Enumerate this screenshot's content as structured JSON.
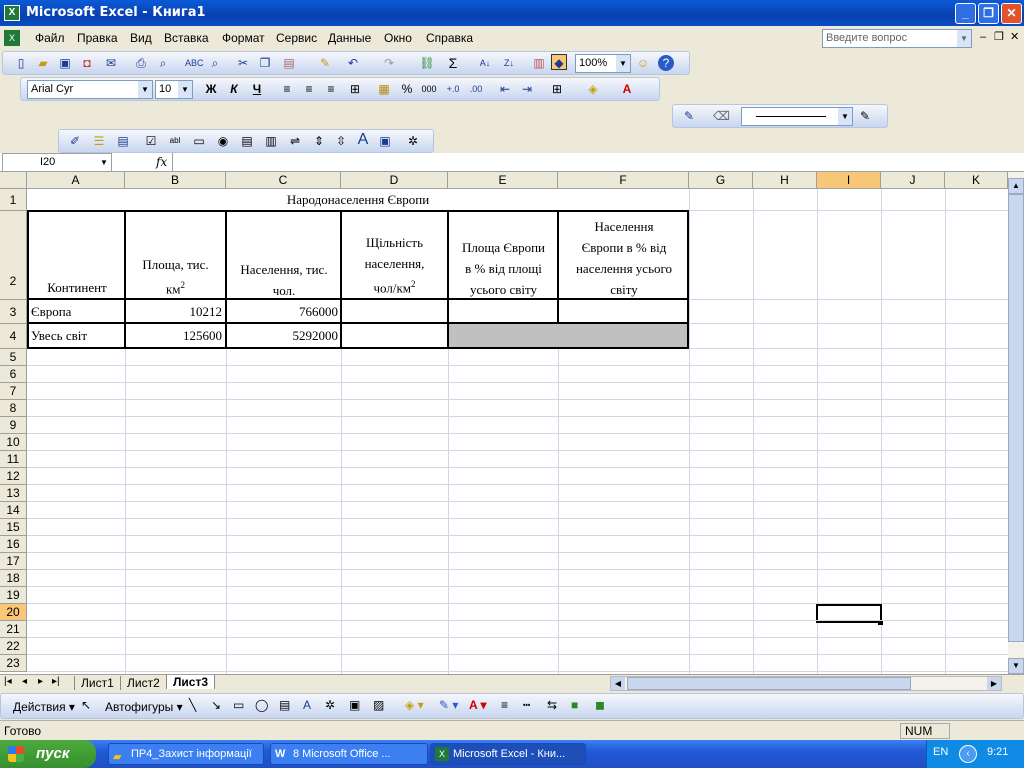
{
  "window": {
    "title": "Microsoft Excel - Книга1",
    "app_icon": "X"
  },
  "menu": {
    "items": [
      "Файл",
      "Правка",
      "Вид",
      "Вставка",
      "Формат",
      "Сервис",
      "Данные",
      "Окно",
      "Справка"
    ],
    "help_placeholder": "Введите вопрос"
  },
  "toolbar": {
    "zoom": "100%",
    "font": "Arial Cyr",
    "font_size": "10",
    "bold": "Ж",
    "italic": "К",
    "underline": "Ч",
    "percent": "%",
    "thousands": "000",
    "sigma": "Σ"
  },
  "formula_bar": {
    "name_box": "I20",
    "fx": "fx",
    "value": ""
  },
  "grid": {
    "columns": [
      "A",
      "B",
      "C",
      "D",
      "E",
      "F",
      "G",
      "H",
      "I",
      "J",
      "K"
    ],
    "rows": [
      "1",
      "2",
      "3",
      "4",
      "5",
      "6",
      "7",
      "8",
      "9",
      "10",
      "11",
      "12",
      "13",
      "14",
      "15",
      "16",
      "17",
      "18",
      "19",
      "20",
      "21",
      "22",
      "23"
    ],
    "active_cell": "I20",
    "selected_column": "I",
    "selected_row": "20"
  },
  "sheet": {
    "title": "Народонаселення Європи",
    "headers": {
      "a": "Континент",
      "b_line1": "Площа, тис.",
      "b_line2": "км",
      "b_sup": "2",
      "c_line1": "Населення, тис.",
      "c_line2": "чол.",
      "d_line1": "Щільність",
      "d_line2": "населення,",
      "d_line3": "чол/км",
      "d_sup": "2",
      "e_line1": "Площа Європи",
      "e_line2": "в % від площі",
      "e_line3": "усього світу",
      "f_line1": "Населення",
      "f_line2": "Європи в % від",
      "f_line3": "населення усього",
      "f_line4": "світу"
    },
    "rows": [
      {
        "a": "Європа",
        "b": "10212",
        "c": "766000"
      },
      {
        "a": "Увесь світ",
        "b": "125600",
        "c": "5292000"
      }
    ],
    "shaded_fill": "#c0c0c0"
  },
  "tabs": {
    "items": [
      "Лист1",
      "Лист2",
      "Лист3"
    ],
    "active": "Лист3"
  },
  "drawing": {
    "actions": "Действия",
    "autoshapes": "Автофигуры"
  },
  "status": {
    "ready": "Готово",
    "num": "NUM"
  },
  "taskbar": {
    "start": "пуск",
    "tasks": [
      "ПР4_Захист інформації",
      "8 Microsoft Office ...",
      "Microsoft Excel - Кни..."
    ],
    "lang": "EN",
    "time": "9:21"
  }
}
